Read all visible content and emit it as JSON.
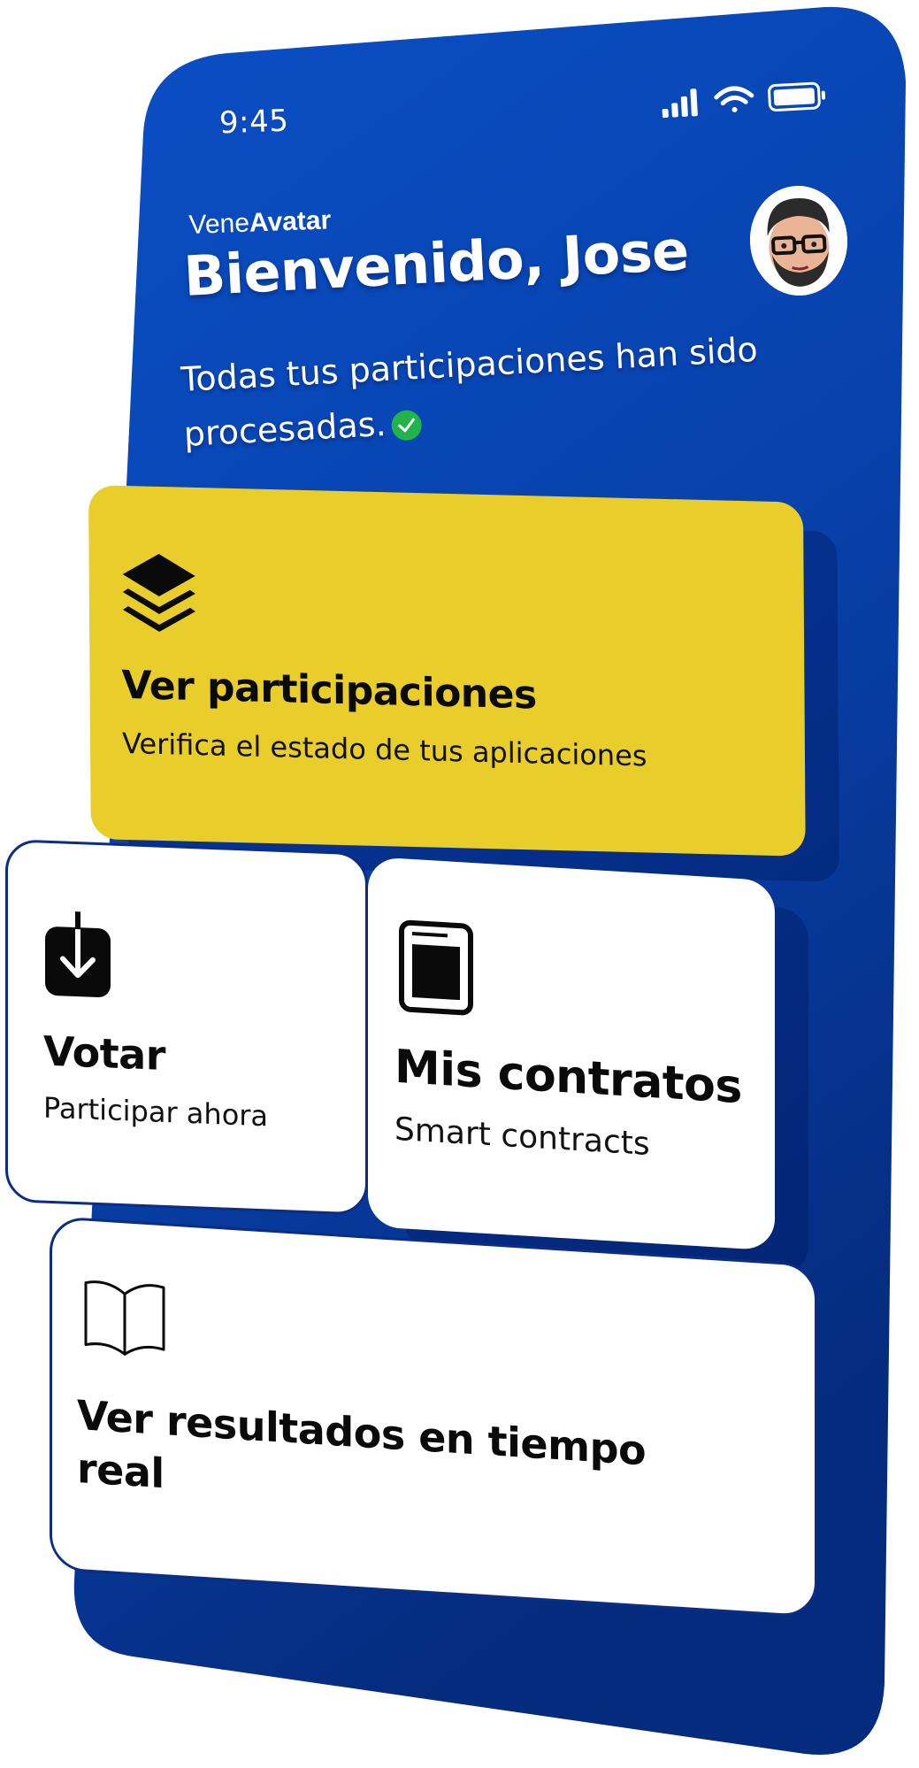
{
  "status_bar": {
    "time": "9:45",
    "icons": [
      "signal-icon",
      "wifi-icon",
      "battery-icon"
    ]
  },
  "header": {
    "brand_prefix": "Vene",
    "brand_bold": "Avatar",
    "welcome": "Bienvenido, Jose",
    "message": "Todas tus participaciones han sido procesadas.",
    "avatar": "user-avatar"
  },
  "cards": {
    "participaciones": {
      "icon": "layers-icon",
      "title": "Ver participaciones",
      "subtitle": "Verifica el estado de tus aplicaciones"
    },
    "votar": {
      "icon": "download-box-icon",
      "title": "Votar",
      "subtitle": "Participar ahora"
    },
    "contratos": {
      "icon": "document-frame-icon",
      "title": "Mis contratos",
      "subtitle": "Smart contracts"
    },
    "resultados": {
      "icon": "open-book-icon",
      "title": "Ver resultados en tiempo real"
    }
  },
  "colors": {
    "phone_blue": "#0a45b8",
    "phone_blue_dark": "#062a7c",
    "accent_yellow": "#e8cd2b",
    "check_green": "#22b44a"
  }
}
